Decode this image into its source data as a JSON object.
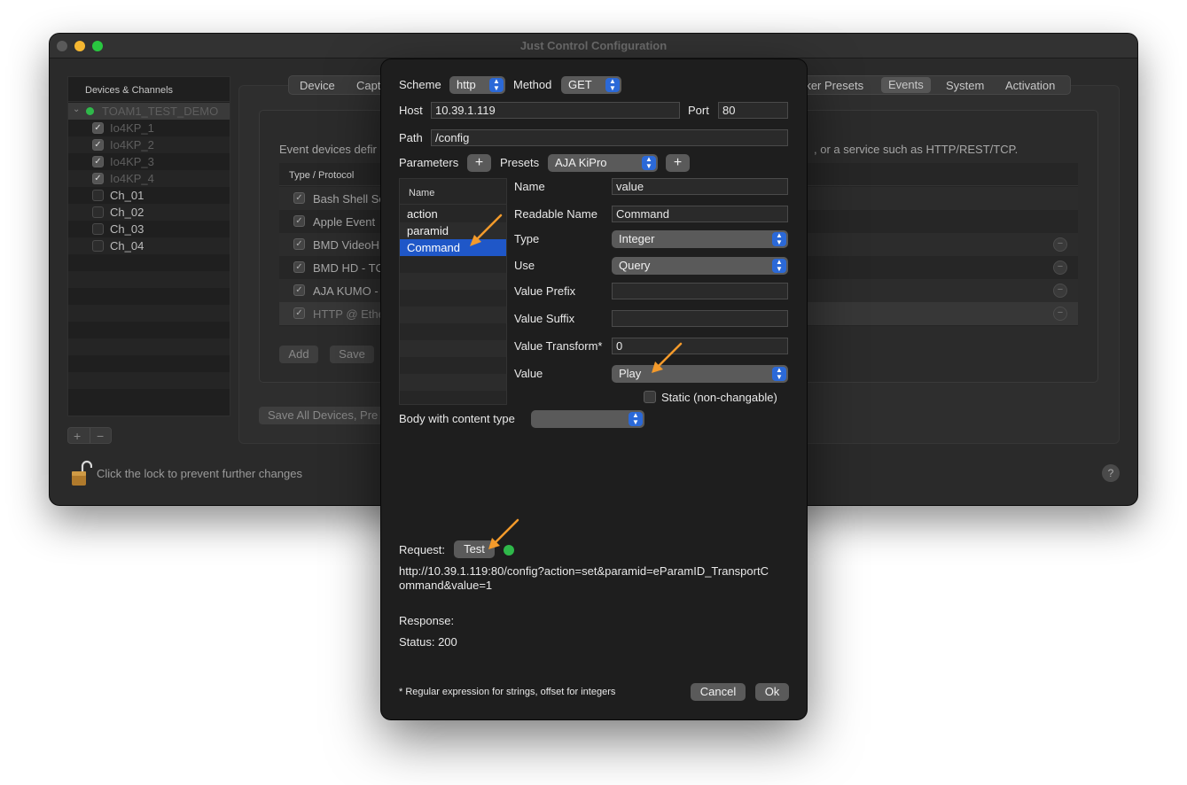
{
  "window": {
    "title": "Just Control Configuration",
    "traffic_lights": [
      "#5a5a5a",
      "#f5b731",
      "#29c740"
    ]
  },
  "sidebar": {
    "header": "Devices & Channels",
    "device": "TOAM1_TEST_DEMO",
    "device_status_color": "#2fb84a",
    "channels": [
      {
        "label": "Io4KP_1",
        "checked": true
      },
      {
        "label": "Io4KP_2",
        "checked": true
      },
      {
        "label": "Io4KP_3",
        "checked": true
      },
      {
        "label": "Io4KP_4",
        "checked": true
      },
      {
        "label": "Ch_01",
        "checked": false
      },
      {
        "label": "Ch_02",
        "checked": false
      },
      {
        "label": "Ch_03",
        "checked": false
      },
      {
        "label": "Ch_04",
        "checked": false
      }
    ],
    "add_label": "+",
    "remove_label": "−"
  },
  "tabs": {
    "device": "Device",
    "capt": "Capt",
    "marker_presets": "rker Presets",
    "events": "Events",
    "system": "System",
    "activation": "Activation"
  },
  "events_panel": {
    "desc_left": "Event devices defir",
    "desc_right": ", or a service such as HTTP/REST/TCP.",
    "column_header": "Type / Protocol",
    "rows": [
      "Bash Shell Sc",
      "Apple Event",
      "BMD VideoH",
      "BMD HD - TC",
      "AJA KUMO -",
      "HTTP @ Ethe"
    ],
    "add_label": "Add",
    "save_label": "Save",
    "save_all_label": "Save All Devices, Pre"
  },
  "footer": {
    "lock_text": "Click the lock to prevent further changes",
    "help": "?"
  },
  "dialog": {
    "scheme_label": "Scheme",
    "scheme_value": "http",
    "method_label": "Method",
    "method_value": "GET",
    "host_label": "Host",
    "host_value": "10.39.1.119",
    "port_label": "Port",
    "port_value": "80",
    "path_label": "Path",
    "path_value": "/config",
    "parameters_label": "Parameters",
    "presets_label": "Presets",
    "presets_value": "AJA KiPro",
    "plus": "+",
    "param_list_header": "Name",
    "params": [
      "action",
      "paramid",
      "Command"
    ],
    "name_label": "Name",
    "name_value": "value",
    "readable_name_label": "Readable Name",
    "readable_name_value": "Command",
    "type_label": "Type",
    "type_value": "Integer",
    "use_label": "Use",
    "use_value": "Query",
    "value_prefix_label": "Value Prefix",
    "value_prefix_value": "",
    "value_suffix_label": "Value Suffix",
    "value_suffix_value": "",
    "value_transform_label": "Value Transform*",
    "value_transform_value": "0",
    "value_label": "Value",
    "value_value": "Play",
    "static_label": "Static (non-changable)",
    "body_label": "Body with content type",
    "body_value": "",
    "request_label": "Request:",
    "test_label": "Test",
    "request_status_color": "#2fb84a",
    "request_url_line1": "http://10.39.1.119:80/config?action=set&paramid=eParamID_TransportC",
    "request_url_line2": "ommand&value=1",
    "response_label": "Response:",
    "status_text": "Status: 200",
    "footnote": "* Regular expression for strings, offset for integers",
    "cancel_label": "Cancel",
    "ok_label": "Ok"
  },
  "colors": {
    "accent": "#2b69d8",
    "selection": "#1f57c8",
    "annotation_arrow": "#f39a2b"
  }
}
